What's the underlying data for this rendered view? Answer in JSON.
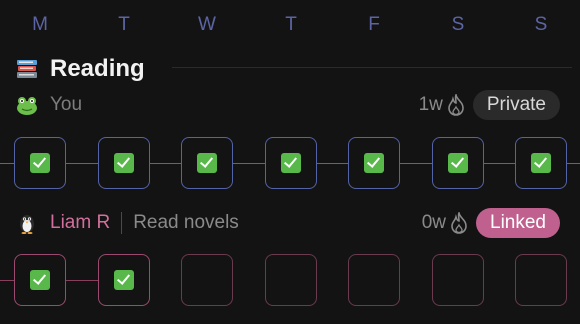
{
  "weekdays": [
    "M",
    "T",
    "W",
    "T",
    "F",
    "S",
    "S"
  ],
  "section": {
    "title": "Reading",
    "icon": "books-icon"
  },
  "rows": [
    {
      "user": "You",
      "avatar": "frog-avatar",
      "streak": "1w",
      "status": "Private",
      "days_checked": [
        true,
        true,
        true,
        true,
        true,
        true,
        true
      ]
    },
    {
      "user": "Liam R",
      "avatar": "penguin-avatar",
      "habit": "Read novels",
      "streak": "0w",
      "status": "Linked",
      "days_checked": [
        true,
        true,
        false,
        false,
        false,
        false,
        false
      ]
    }
  ],
  "colors": {
    "background": "#131313",
    "own_track": "#5462a6",
    "friend_track": "#86405e",
    "linked_badge": "#c0608e",
    "check": "#58b84a"
  }
}
